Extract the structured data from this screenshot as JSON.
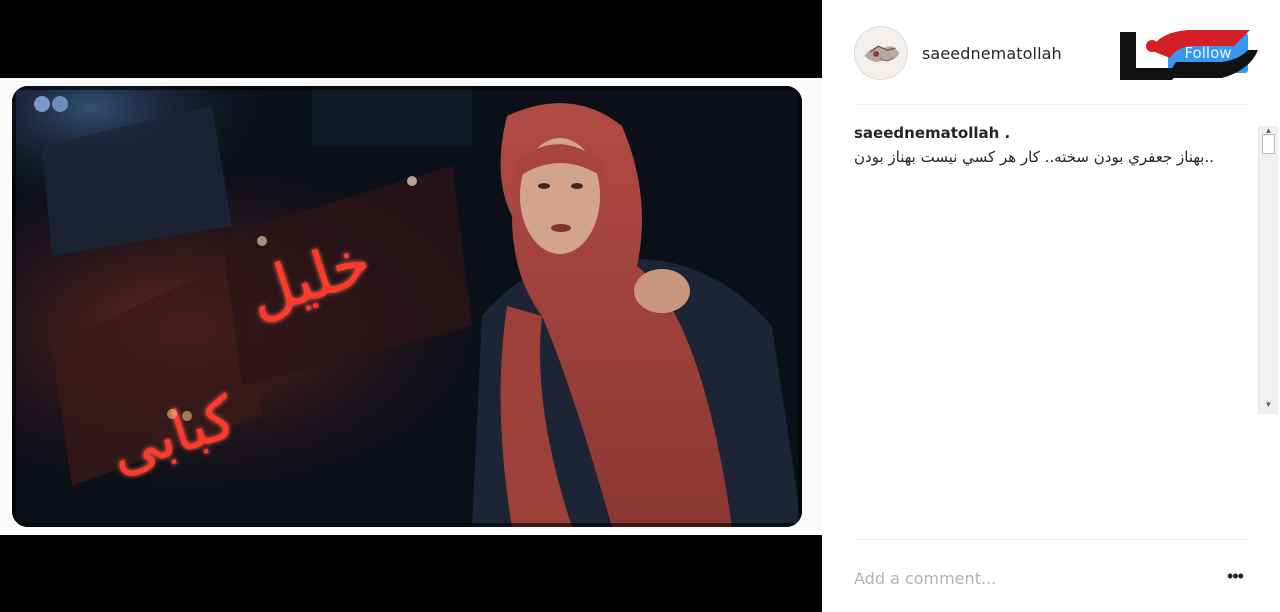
{
  "post": {
    "username": "saeednematollah",
    "follow_label": "Follow",
    "caption_user": "saeednematollah .",
    "caption_text": "..بهناز جعفري بودن سخته.. كار هر كسي نيست بهناز بودن",
    "comment_placeholder": "Add a comment...",
    "more_label": "•••"
  },
  "photo": {
    "sign_text_top": "خلیل",
    "sign_text_bottom": "كبابی"
  },
  "icons": {
    "avatar": "avatar-icon",
    "logo": "site-logo",
    "more": "ellipsis-icon",
    "scroll_up": "▲",
    "scroll_down": "▼"
  },
  "colors": {
    "follow_bg": "#3897f0",
    "logo_red": "#d41f26",
    "logo_black": "#111111",
    "neon_red": "#ff4a3a"
  }
}
